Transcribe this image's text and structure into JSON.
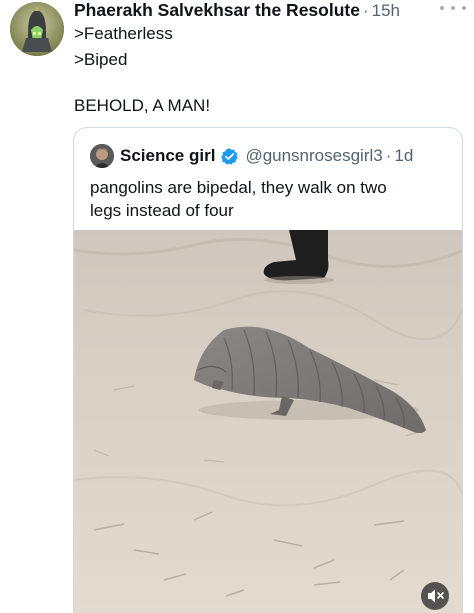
{
  "post": {
    "author_name": "Phaerakh Salvekhsar the Resolute",
    "separator": "·",
    "time": "15h",
    "lines": [
      ">Featherless",
      ">Biped",
      "BEHOLD, A MAN!"
    ]
  },
  "quoted": {
    "name": "Science girl",
    "handle": "@gunsnrosesgirl3",
    "separator": "·",
    "time": "1d",
    "text": "pangolins are bipedal, they walk on two legs instead of four"
  },
  "colors": {
    "verified": "#1d9bf0",
    "muted_text": "#536471",
    "border": "#cfd9de"
  },
  "icons": {
    "more": "more-horizontal-icon",
    "verified": "verified-badge-icon",
    "mute": "speaker-muted-icon"
  }
}
